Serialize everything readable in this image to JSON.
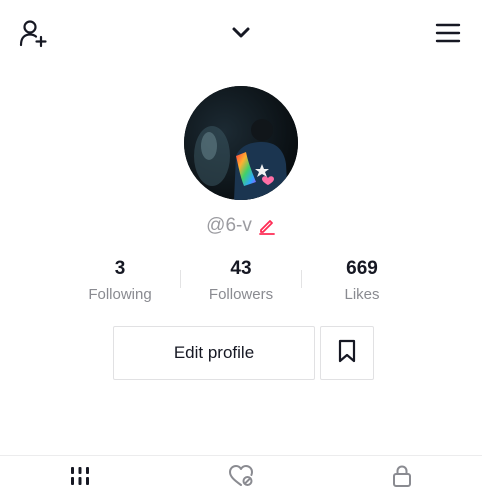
{
  "header": {
    "icons": {
      "add_friend": "add-user-icon",
      "account_switch": "chevron-down-icon",
      "menu": "hamburger-menu-icon"
    }
  },
  "profile": {
    "handle": "@6-v",
    "avatar": "profile-photo"
  },
  "stats": [
    {
      "value": "3",
      "label": "Following"
    },
    {
      "value": "43",
      "label": "Followers"
    },
    {
      "value": "669",
      "label": "Likes"
    }
  ],
  "actions": {
    "edit_profile_label": "Edit profile",
    "bookmark_icon": "bookmark-icon"
  },
  "tabs": [
    {
      "icon": "videos-grid-icon",
      "selected": true
    },
    {
      "icon": "liked-videos-icon",
      "selected": false
    },
    {
      "icon": "lock-icon",
      "selected": false
    }
  ],
  "colors": {
    "accent": "#fe2c55",
    "text": "#161823",
    "muted": "#8a8b91",
    "border": "#e1e1e3"
  }
}
